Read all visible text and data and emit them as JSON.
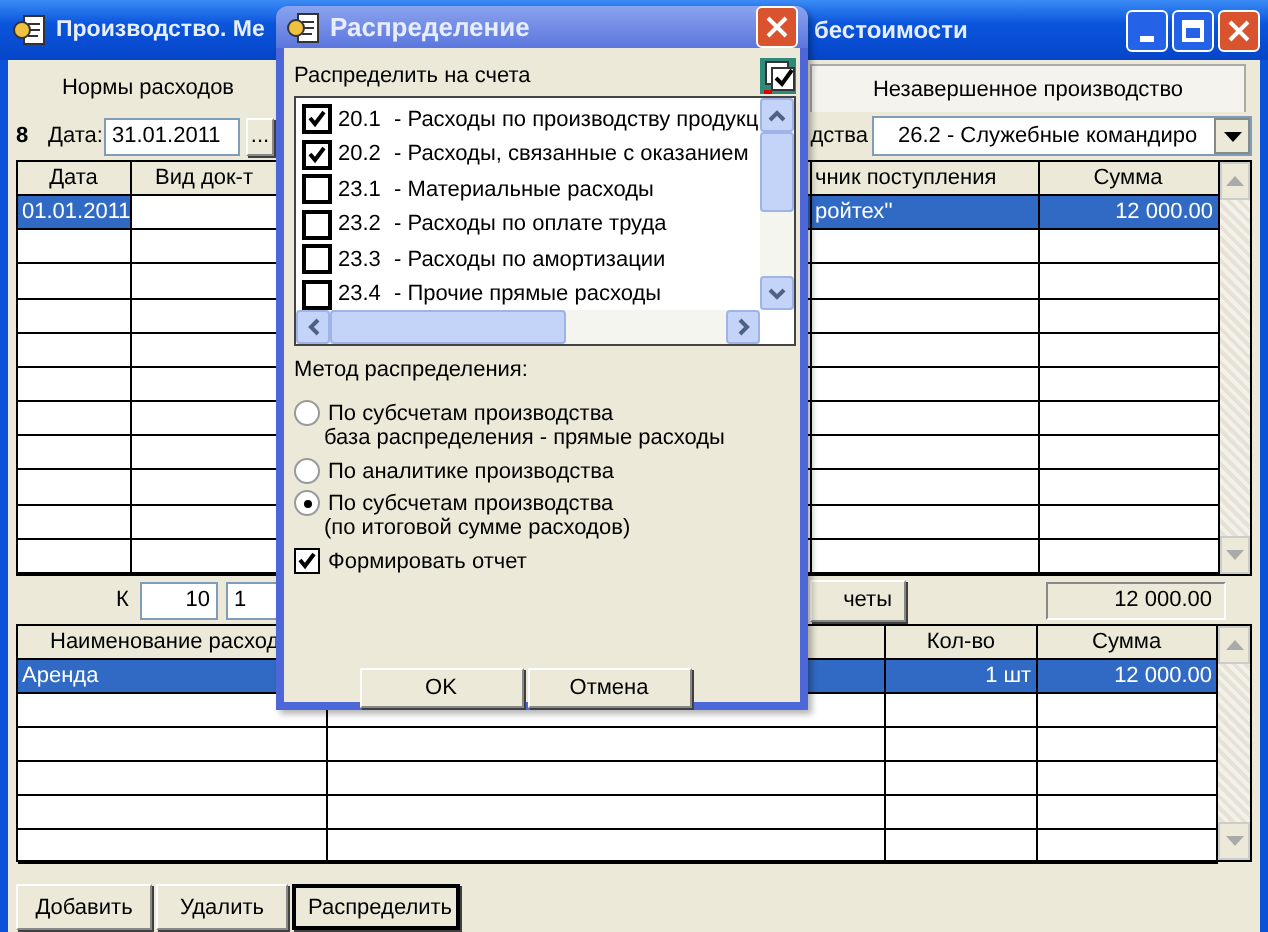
{
  "main_window": {
    "title_start": "Производство. Ме",
    "title_end": "бестоимости"
  },
  "tabs": [
    {
      "label": "Нормы расходов",
      "selected": false
    },
    {
      "label": "Незавершенное производство",
      "selected": false
    }
  ],
  "filter": {
    "number": "8",
    "date_label": "Дата:",
    "date": "31.01.2011",
    "picker_button": "...",
    "account_label_tail": "дства",
    "account": "26.2  - Служебные командиро"
  },
  "documents_table": {
    "columns": [
      "Дата",
      "Вид док-т",
      "чник поступления",
      "Сумма"
    ],
    "rows": [
      {
        "date": "01.01.2011",
        "source": "ройтех''",
        "amount": "12 000.00",
        "selected": true
      }
    ]
  },
  "totals": {
    "k_label": "К",
    "k_value": "10",
    "field_2": "1",
    "button_tail": "четы",
    "total": "12 000.00"
  },
  "expenses_table": {
    "columns": [
      "Наименование расход",
      "Кол-во",
      "Сумма"
    ],
    "rows": [
      {
        "name": "Аренда",
        "qty": "1 шт",
        "amount": "12 000.00",
        "selected": true
      }
    ]
  },
  "buttons": [
    {
      "label": "Добавить",
      "default": false
    },
    {
      "label": "Удалить",
      "default": false
    },
    {
      "label": "Распределить",
      "default": true
    }
  ],
  "dialog": {
    "title": "Распределение",
    "accounts_label": "Распределить на счета",
    "accounts": [
      {
        "code": "20.1",
        "name": "- Расходы по производству продукц",
        "checked": true
      },
      {
        "code": "20.2",
        "name": "- Расходы, связанные с оказанием",
        "checked": true
      },
      {
        "code": "23.1",
        "name": "- Материальные расходы",
        "checked": false
      },
      {
        "code": "23.2",
        "name": "- Расходы по оплате труда",
        "checked": false
      },
      {
        "code": "23.3",
        "name": "- Расходы по амортизации",
        "checked": false
      },
      {
        "code": "23.4",
        "name": "- Прочие прямые расходы",
        "checked": false
      }
    ],
    "method_label": "Метод распределения:",
    "methods": [
      {
        "label": "По субсчетам производства",
        "note": "база распределения - прямые расходы",
        "selected": false
      },
      {
        "label": "По аналитике производства",
        "selected": false
      },
      {
        "label": "По субсчетам производства",
        "note": "(по итоговой сумме расходов)",
        "selected": true
      }
    ],
    "report": {
      "label": "Формировать отчет",
      "checked": true
    },
    "buttons": [
      "OK",
      "Отмена"
    ]
  }
}
